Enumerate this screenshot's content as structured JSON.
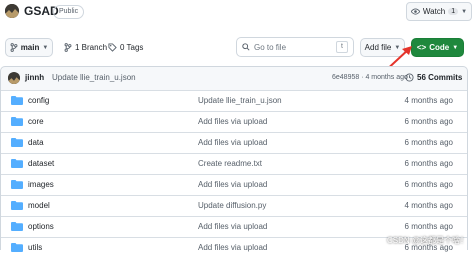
{
  "repo": {
    "name": "GSAD",
    "visibility": "Public",
    "watch_label": "Watch",
    "watch_count": "1"
  },
  "toolbar": {
    "branch": "main",
    "branches": "1 Branch",
    "tags": "0 Tags",
    "search_placeholder": "Go to file",
    "search_shortcut": "t",
    "add_file": "Add file",
    "code": "Code"
  },
  "commit": {
    "author": "jinnh",
    "message": "Update llie_train_u.json",
    "sha_time": "6e48958 · 4 months ago",
    "commits": "56 Commits"
  },
  "files": [
    {
      "name": "config",
      "message": "Update llie_train_u.json",
      "time": "4 months ago"
    },
    {
      "name": "core",
      "message": "Add files via upload",
      "time": "6 months ago"
    },
    {
      "name": "data",
      "message": "Add files via upload",
      "time": "6 months ago"
    },
    {
      "name": "dataset",
      "message": "Create readme.txt",
      "time": "6 months ago"
    },
    {
      "name": "images",
      "message": "Add files via upload",
      "time": "6 months ago"
    },
    {
      "name": "model",
      "message": "Update diffusion.py",
      "time": "4 months ago"
    },
    {
      "name": "options",
      "message": "Add files via upload",
      "time": "6 months ago"
    },
    {
      "name": "utils",
      "message": "Add files via upload",
      "time": "6 months ago"
    }
  ],
  "watermark": "CSDN @这都是个啥！",
  "colors": {
    "accent_green": "#1f883d",
    "folder_blue": "#54aeff",
    "arrow_red": "#e5342b"
  }
}
